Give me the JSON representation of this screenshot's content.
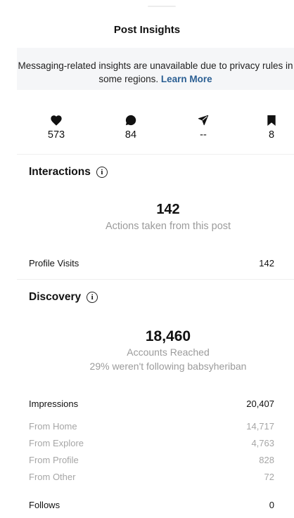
{
  "header": {
    "title": "Post Insights"
  },
  "notice": {
    "text": "Messaging-related insights are unavailable due to privacy rules in some regions.",
    "link": "Learn More"
  },
  "stats": [
    {
      "icon": "heart-icon",
      "value": "573"
    },
    {
      "icon": "comment-icon",
      "value": "84"
    },
    {
      "icon": "share-icon",
      "value": "--"
    },
    {
      "icon": "bookmark-icon",
      "value": "8"
    }
  ],
  "interactions": {
    "title": "Interactions",
    "total": "142",
    "caption": "Actions taken from this post",
    "rows": [
      {
        "label": "Profile Visits",
        "value": "142"
      }
    ]
  },
  "discovery": {
    "title": "Discovery",
    "total": "18,460",
    "caption": "Accounts Reached",
    "subcaption": "29% weren't following babsyheriban",
    "impressions": {
      "label": "Impressions",
      "value": "20,407"
    },
    "sources": [
      {
        "label": "From Home",
        "value": "14,717"
      },
      {
        "label": "From Explore",
        "value": "4,763"
      },
      {
        "label": "From Profile",
        "value": "828"
      },
      {
        "label": "From Other",
        "value": "72"
      }
    ],
    "follows": {
      "label": "Follows",
      "value": "0"
    }
  }
}
